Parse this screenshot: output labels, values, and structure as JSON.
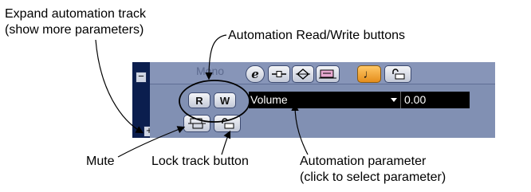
{
  "track": {
    "mode_label": "Mono",
    "read_button": "R",
    "write_button": "W",
    "parameter": "Volume",
    "value": "0.00",
    "collapse_top": "−",
    "collapse_sub": "−",
    "expand_sub": "+"
  },
  "callouts": {
    "expand_line1": "Expand automation track",
    "expand_line2": "(show more parameters)",
    "read_write": "Automation Read/Write buttons",
    "mute": "Mute",
    "lock": "Lock track button",
    "param_line1": "Automation parameter",
    "param_line2": "(click to select parameter)"
  },
  "colors": {
    "panel": "#8190b3",
    "strip": "#0b1e4e",
    "field": "#000000",
    "orange_button": "#f0a030"
  },
  "icons": [
    "edit-icon",
    "insert-icon",
    "eq-icon",
    "channel-icon",
    "note-icon",
    "lock-icon",
    "mute-icon"
  ]
}
